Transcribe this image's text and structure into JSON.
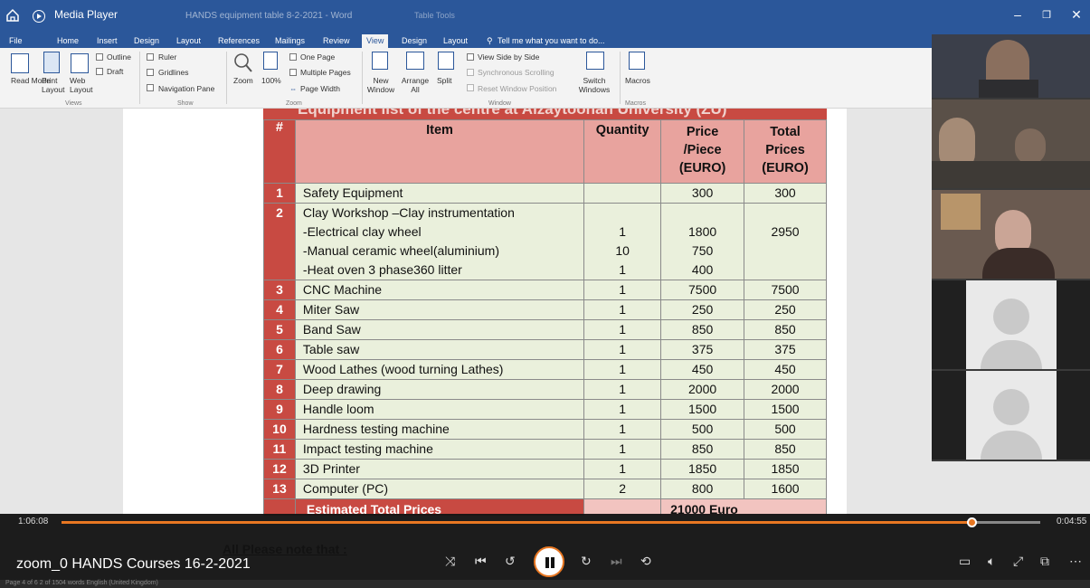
{
  "titlebar": {
    "app_name": "Media Player",
    "doc_title": "HANDS equipment table 8-2-2021 - Word",
    "context_title": "Table Tools"
  },
  "ribbon": {
    "tabs": [
      "File",
      "Home",
      "Insert",
      "Design",
      "Layout",
      "References",
      "Mailings",
      "Review",
      "View",
      "Design",
      "Layout"
    ],
    "active_tab": "View",
    "tell_me": "Tell me what you want to do...",
    "views": {
      "read_mode": "Read Mode",
      "print_layout": "Print Layout",
      "web_layout": "Web Layout",
      "outline": "Outline",
      "draft": "Draft",
      "group": "Views"
    },
    "show": {
      "ruler": "Ruler",
      "gridlines": "Gridlines",
      "navigation_pane": "Navigation Pane",
      "group": "Show"
    },
    "zoom": {
      "zoom": "Zoom",
      "hundred": "100%",
      "one_page": "One Page",
      "multiple_pages": "Multiple Pages",
      "page_width": "Page Width",
      "group": "Zoom"
    },
    "window": {
      "new_window": "New Window",
      "arrange_all": "Arrange All",
      "split": "Split",
      "side_by_side": "View Side by Side",
      "sync_scroll": "Synchronous Scrolling",
      "reset_pos": "Reset Window Position",
      "switch": "Switch Windows",
      "group": "Window"
    },
    "macros": {
      "label": "Macros",
      "group": "Macros"
    }
  },
  "document": {
    "table_title": "Equipment list of the centre at Alzaytoonah University (ZU)",
    "headers": {
      "num": "#",
      "item": "Item",
      "quantity": "Quantity",
      "price": [
        "Price",
        "/Piece",
        "(EURO)"
      ],
      "total": [
        "Total",
        "Prices",
        "(EURO)"
      ]
    },
    "rows": [
      {
        "num": "1",
        "item": [
          "Safety Equipment"
        ],
        "qty": [
          ""
        ],
        "price": [
          "300"
        ],
        "total": [
          "300"
        ]
      },
      {
        "num": "2",
        "item": [
          "Clay Workshop –Clay instrumentation",
          "-Electrical clay wheel",
          "-Manual ceramic wheel(aluminium)",
          "-Heat oven 3 phase360 litter"
        ],
        "qty": [
          "",
          "1",
          "10",
          "1"
        ],
        "price": [
          "",
          "1800",
          "750",
          "400"
        ],
        "total": [
          "",
          "2950",
          "",
          ""
        ]
      },
      {
        "num": "3",
        "item": [
          "CNC Machine"
        ],
        "qty": [
          "1"
        ],
        "price": [
          "7500"
        ],
        "total": [
          "7500"
        ]
      },
      {
        "num": "4",
        "item": [
          "Miter Saw"
        ],
        "qty": [
          "1"
        ],
        "price": [
          "250"
        ],
        "total": [
          "250"
        ]
      },
      {
        "num": "5",
        "item": [
          "Band Saw"
        ],
        "qty": [
          "1"
        ],
        "price": [
          "850"
        ],
        "total": [
          "850"
        ]
      },
      {
        "num": "6",
        "item": [
          "Table saw"
        ],
        "qty": [
          "1"
        ],
        "price": [
          "375"
        ],
        "total": [
          "375"
        ]
      },
      {
        "num": "7",
        "item": [
          "Wood Lathes (wood turning Lathes)"
        ],
        "qty": [
          "1"
        ],
        "price": [
          "450"
        ],
        "total": [
          "450"
        ]
      },
      {
        "num": "8",
        "item": [
          "Deep drawing"
        ],
        "qty": [
          "1"
        ],
        "price": [
          "2000"
        ],
        "total": [
          "2000"
        ]
      },
      {
        "num": "9",
        "item": [
          "Handle loom"
        ],
        "qty": [
          "1"
        ],
        "price": [
          "1500"
        ],
        "total": [
          "1500"
        ]
      },
      {
        "num": "10",
        "item": [
          "Hardness testing machine"
        ],
        "qty": [
          "1"
        ],
        "price": [
          "500"
        ],
        "total": [
          "500"
        ]
      },
      {
        "num": "11",
        "item": [
          "Impact testing machine"
        ],
        "qty": [
          "1"
        ],
        "price": [
          "850"
        ],
        "total": [
          "850"
        ]
      },
      {
        "num": "12",
        "item": [
          "3D Printer"
        ],
        "qty": [
          "1"
        ],
        "price": [
          "1850"
        ],
        "total": [
          "1850"
        ]
      },
      {
        "num": "13",
        "item": [
          "Computer (PC)"
        ],
        "qty": [
          "2"
        ],
        "price": [
          "800"
        ],
        "total": [
          "1600"
        ]
      }
    ],
    "total_label": "Estimated Total Prices",
    "total_value": "21000 Euro",
    "note": "All Please note that :"
  },
  "player": {
    "elapsed": "1:06:08",
    "remaining": "0:04:55",
    "progress_fraction": 0.93,
    "title": "zoom_0 HANDS Courses 16-2-2021"
  },
  "statusbar": {
    "text": "Page 4 of 6    2 of 1504 words    English (United Kingdom)"
  },
  "colors": {
    "word_blue": "#2b579a",
    "table_red": "#c84a42",
    "table_header_pink": "#e8a39e",
    "row_green": "#eaf0dc",
    "accent_orange": "#e87722"
  }
}
